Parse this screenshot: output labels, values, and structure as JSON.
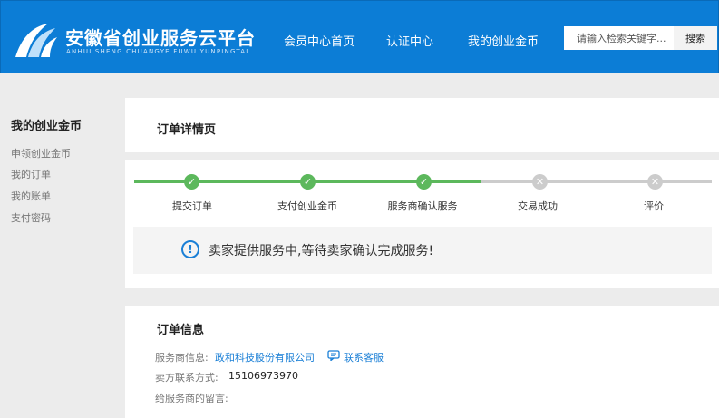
{
  "header": {
    "title": "安徽省创业服务云平台",
    "subtitle": "ANHUI SHENG CHUANGYE FUWU YUNPINGTAI",
    "nav": [
      "会员中心首页",
      "认证中心",
      "我的创业金币"
    ],
    "search_placeholder": "请输入检索关键字...",
    "search_button": "搜索"
  },
  "sidebar": {
    "title": "我的创业金币",
    "items": [
      "申领创业金币",
      "我的订单",
      "我的账单",
      "支付密码"
    ]
  },
  "order_detail": {
    "title": "订单详情页",
    "steps": [
      {
        "label": "提交订单",
        "done": true
      },
      {
        "label": "支付创业金币",
        "done": true
      },
      {
        "label": "服务商确认服务",
        "done": true
      },
      {
        "label": "交易成功",
        "done": false
      },
      {
        "label": "评价",
        "done": false
      }
    ],
    "notice": "卖家提供服务中,等待卖家确认完成服务!"
  },
  "order_info": {
    "title": "订单信息",
    "provider_label": "服务商信息:",
    "provider_name": "政和科技股份有限公司",
    "contact_service": "联系客服",
    "seller_phone_label": "卖方联系方式:",
    "seller_phone": "15106973970",
    "message_label": "给服务商的留言:"
  },
  "colors": {
    "header_bg": "#0c7dd6",
    "step_done": "#5cb85c",
    "step_pending": "#cccccc",
    "link": "#1a7fd6"
  }
}
